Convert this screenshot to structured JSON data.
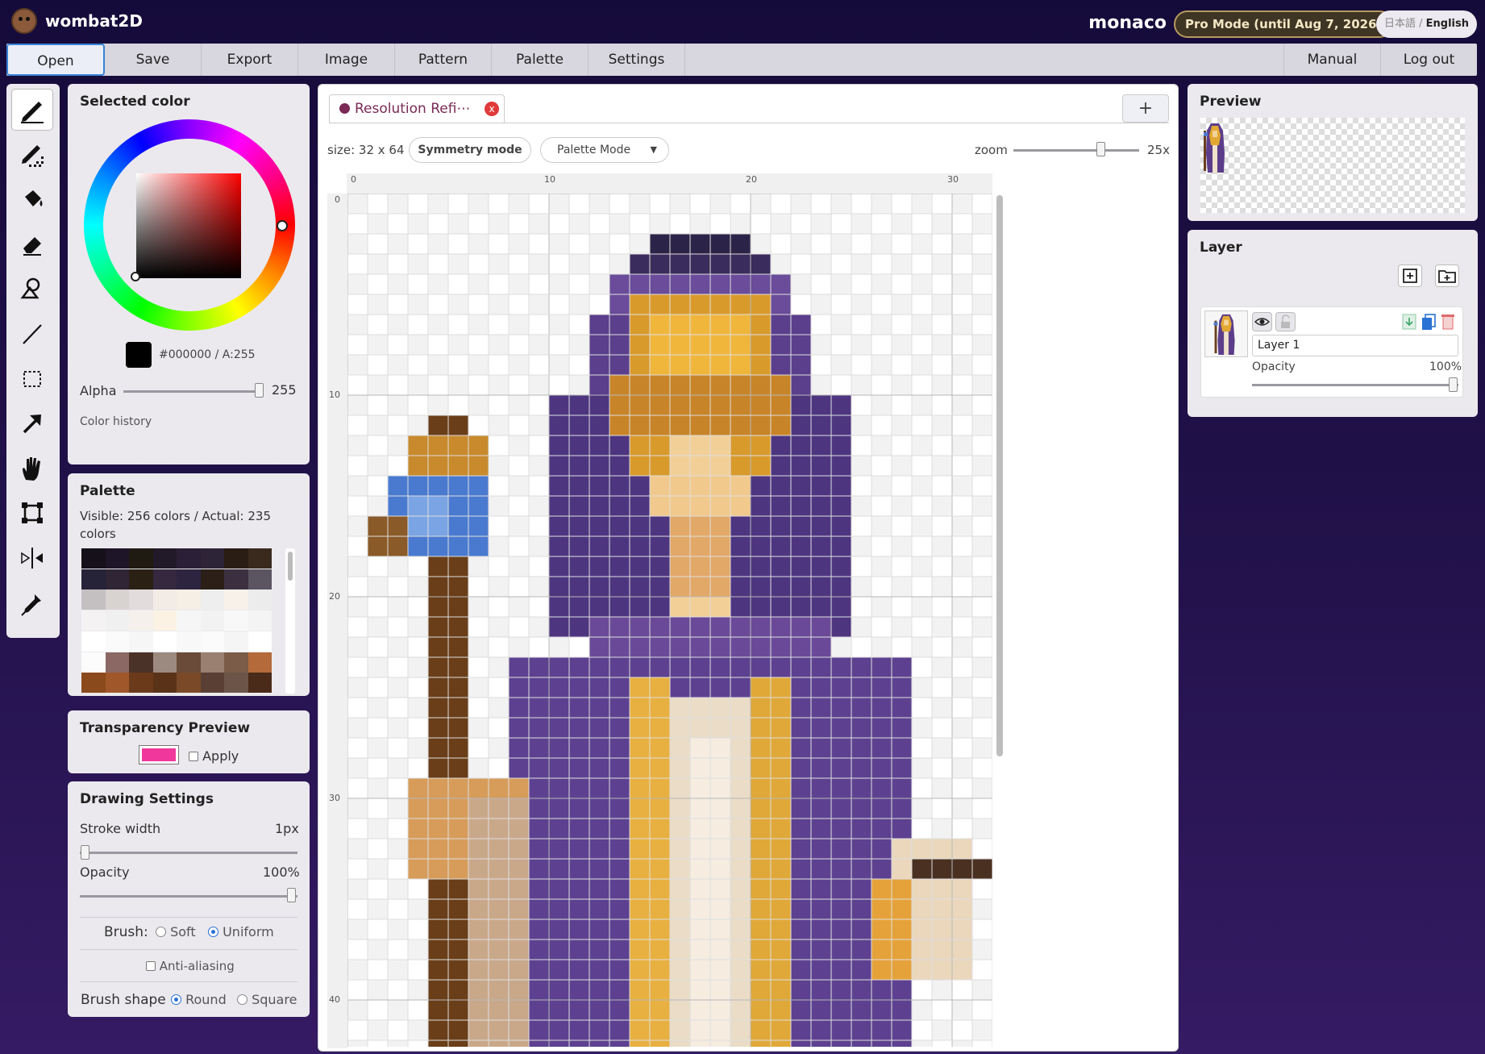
{
  "app": {
    "name": "wombat2D",
    "user": "monaco",
    "pro_badge": "Pro Mode (until Aug 7, 2026)",
    "lang_ja": "日本語",
    "lang_sep": "/",
    "lang_en": "English"
  },
  "menu": {
    "items": [
      "Open",
      "Save",
      "Export",
      "Image",
      "Pattern",
      "Palette",
      "Settings"
    ],
    "right": [
      "Manual",
      "Log out"
    ]
  },
  "tools": [
    "pencil-icon",
    "dither-pencil-icon",
    "fill-bucket-icon",
    "eraser-icon",
    "shape-icon",
    "line-icon",
    "rect-select-icon",
    "move-arrow-icon",
    "hand-icon",
    "crop-icon",
    "mirror-icon",
    "eyedropper-icon"
  ],
  "color": {
    "title": "Selected color",
    "hex": "#000000 / A:255",
    "alpha_label": "Alpha",
    "alpha_value": "255",
    "history_label": "Color history",
    "current": "#000000"
  },
  "palette": {
    "title": "Palette",
    "info": "Visible: 256 colors / Actual: 235 colors",
    "swatches": [
      "#15101a",
      "#1e1528",
      "#1f1a12",
      "#221a28",
      "#2a1f36",
      "#2d2438",
      "#2a1d14",
      "#3a2a1e",
      "#262238",
      "#2f2535",
      "#2a2014",
      "#36283e",
      "#2d2440",
      "#2b1f17",
      "#3c3040",
      "#5a5560",
      "#c4c0c2",
      "#d8d2d0",
      "#e2dcdc",
      "#f3ece6",
      "#f5efe6",
      "#eeeeee",
      "#f7f1e9",
      "#ececec",
      "#f4f2f2",
      "#f0f0f0",
      "#f5f0ec",
      "#fbf2e4",
      "#f6f6f6",
      "#f2f2f2",
      "#f8f8f8",
      "#f4f4f4",
      "#ffffff",
      "#fafafa",
      "#f6f6f6",
      "#ffffff",
      "#f8f8f8",
      "#fbfbfb",
      "#f5f5f5",
      "#ffffff",
      "#fcfcfc",
      "#8b6864",
      "#4a3228",
      "#9c8a80",
      "#6a4a38",
      "#9a8070",
      "#7a5c48",
      "#b46a3a",
      "#8a4a1c",
      "#a0582a",
      "#6a3a1a",
      "#5a3218",
      "#7a4a28",
      "#5a4034",
      "#6c5448",
      "#4a2a18"
    ]
  },
  "transparency": {
    "title": "Transparency Preview",
    "apply_label": "Apply",
    "color": "#f0379c"
  },
  "drawing": {
    "title": "Drawing Settings",
    "stroke_label": "Stroke width",
    "stroke_value": "1px",
    "opacity_label": "Opacity",
    "opacity_value": "100%",
    "brush_label": "Brush:",
    "brush_soft": "Soft",
    "brush_uniform": "Uniform",
    "aa_label": "Anti-aliasing",
    "shape_label": "Brush shape",
    "shape_round": "Round",
    "shape_square": "Square"
  },
  "canvas": {
    "tab_title": "Resolution Refi⋯",
    "close": "x",
    "new_tab": "+",
    "size": "size: 32 x 64",
    "symmetry": "Symmetry mode",
    "mode_select": "Palette Mode",
    "zoom_label": "zoom",
    "zoom_value": "25x",
    "ruler_x": [
      "0",
      "10",
      "20",
      "30"
    ],
    "ruler_y": [
      "0",
      "10",
      "20",
      "30",
      "40"
    ]
  },
  "preview": {
    "title": "Preview"
  },
  "layer": {
    "title": "Layer",
    "name": "Layer 1",
    "opacity_label": "Opacity",
    "opacity_value": "100%"
  },
  "colors": {
    "accent": "#3a82d8",
    "menu_bg": "#d8d6de",
    "panel_bg": "#ebe9ee",
    "tab_color": "#7a2a55",
    "pro_border": "#b79a5c"
  }
}
